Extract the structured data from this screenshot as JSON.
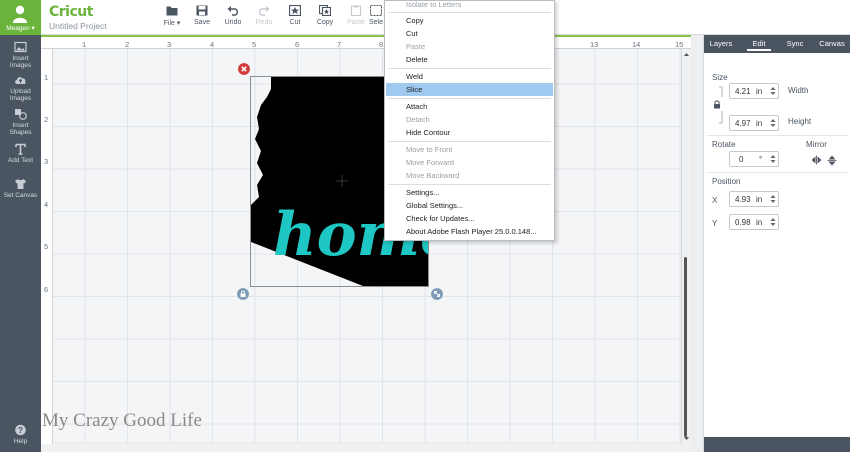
{
  "app": {
    "logo": "Cricut",
    "project_name": "Untitled Project"
  },
  "user": {
    "name": "Meagen ▾"
  },
  "sidebar": {
    "items": [
      {
        "label": "Insert\nImages",
        "l1": "Insert",
        "l2": "Images"
      },
      {
        "label": "Upload\nImages",
        "l1": "Upload",
        "l2": "Images"
      },
      {
        "label": "Insert\nShapes",
        "l1": "Insert",
        "l2": "Shapes"
      },
      {
        "label": "Add Text",
        "l1": "Add Text",
        "l2": ""
      },
      {
        "label": "Set Canvas",
        "l1": "Set Canvas",
        "l2": ""
      },
      {
        "label": "Help",
        "l1": "Help",
        "l2": ""
      }
    ]
  },
  "toolbar": {
    "file_label": "File ▾",
    "save_label": "Save",
    "undo_label": "Undo",
    "redo_label": "Redo",
    "cut_label": "Cut",
    "copy_label": "Copy",
    "paste_label": "Paste",
    "select_label": "Sele"
  },
  "ruler": {
    "top": [
      "1",
      "2",
      "3",
      "4",
      "5",
      "6",
      "7",
      "8",
      "13",
      "14",
      "15"
    ],
    "left": [
      "1",
      "2",
      "3",
      "4",
      "5",
      "6"
    ]
  },
  "context_menu": {
    "items": [
      {
        "label": "Isolate to Letters",
        "disabled": true
      },
      {
        "label": "Copy",
        "disabled": false
      },
      {
        "label": "Cut",
        "disabled": false
      },
      {
        "label": "Paste",
        "disabled": true
      },
      {
        "label": "Delete",
        "disabled": false
      },
      {
        "label": "Weld",
        "disabled": false
      },
      {
        "label": "Slice",
        "disabled": false,
        "highlighted": true
      },
      {
        "label": "Attach",
        "disabled": false
      },
      {
        "label": "Detach",
        "disabled": true
      },
      {
        "label": "Hide Contour",
        "disabled": false
      },
      {
        "label": "Move to Front",
        "disabled": true
      },
      {
        "label": "Move Forward",
        "disabled": true
      },
      {
        "label": "Move Backward",
        "disabled": true
      },
      {
        "label": "Settings...",
        "disabled": false
      },
      {
        "label": "Global Settings...",
        "disabled": false
      },
      {
        "label": "Check for Updates...",
        "disabled": false
      },
      {
        "label": "About Adobe Flash Player 25.0.0.148...",
        "disabled": false
      }
    ]
  },
  "design": {
    "text": "home."
  },
  "panel": {
    "tabs": [
      "Layers",
      "Edit",
      "Sync",
      "Canvas"
    ],
    "active_tab": "Edit",
    "size": {
      "label": "Size",
      "width": "4.21",
      "width_unit": "in",
      "width_label": "Width",
      "height": "4.97",
      "height_unit": "in",
      "height_label": "Height"
    },
    "rotate": {
      "label": "Rotate",
      "value": "0",
      "unit": "°"
    },
    "mirror": {
      "label": "Mirror"
    },
    "position": {
      "label": "Position",
      "x_label": "X",
      "x": "4.93",
      "x_unit": "in",
      "y_label": "Y",
      "y": "0.98",
      "y_unit": "in"
    }
  },
  "watermark": "My Crazy Good Life",
  "colors": {
    "accent": "#6bb43c",
    "sidebar": "#4a5561",
    "teal_text": "#1fc7c4",
    "highlight": "#9fc9ee"
  }
}
